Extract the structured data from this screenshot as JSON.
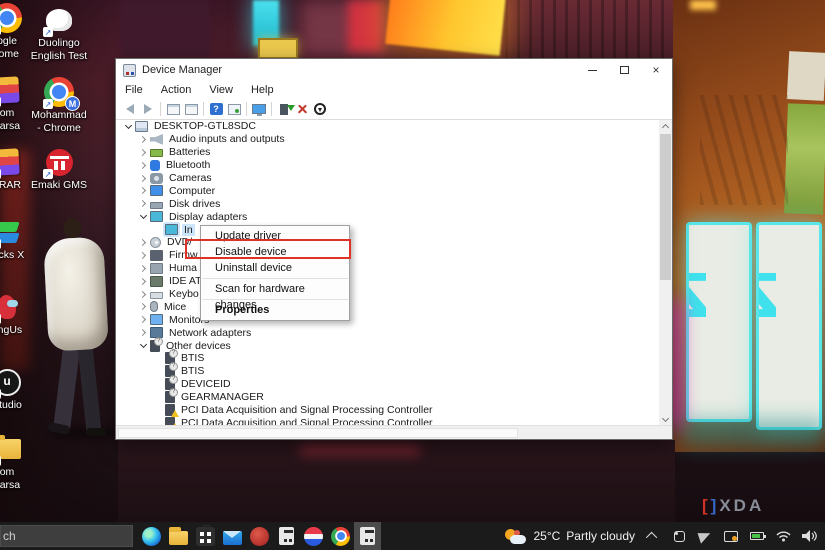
{
  "desktop": {
    "columns": [
      {
        "items": [
          {
            "art": "chrome",
            "lines": [
              "ogle",
              "rome"
            ]
          },
          {
            "art": "rar",
            "lines": [
              "om",
              "darsa"
            ]
          },
          {
            "art": "winrar",
            "lines": [
              "nRAR"
            ]
          },
          {
            "art": "bluestacks",
            "lines": [
              "tacks X"
            ]
          },
          {
            "art": "amongus",
            "lines": [
              "ongUs"
            ]
          },
          {
            "art": "studio",
            "lines": [
              "Studio"
            ]
          },
          {
            "art": "folder",
            "lines": [
              "om",
              "darsa"
            ]
          }
        ]
      },
      {
        "items": [
          {
            "art": "duolingo",
            "lines": [
              "Duolingo",
              "English Test"
            ]
          },
          {
            "art": "chrome-m",
            "lines": [
              "Mohammad",
              "- Chrome"
            ],
            "badge": "M"
          },
          {
            "art": "emaki",
            "lines": [
              "Emaki GMS"
            ]
          }
        ]
      }
    ]
  },
  "window": {
    "title": "Device Manager",
    "menubar": [
      "File",
      "Action",
      "View",
      "Help"
    ],
    "toolbar": [
      "back",
      "forward",
      "sep",
      "console-tree",
      "properties",
      "sep",
      "help",
      "console-window",
      "sep",
      "remote-desktop",
      "sep",
      "update-driver",
      "uninstall",
      "disable-device"
    ],
    "tree": [
      {
        "label": "DESKTOP-GTL8SDC",
        "level": 0,
        "state": "expanded",
        "icon": "computer-icon"
      },
      {
        "label": "Audio inputs and outputs",
        "level": 1,
        "state": "collapsed",
        "icon": "audio-icon"
      },
      {
        "label": "Batteries",
        "level": 1,
        "state": "collapsed",
        "icon": "battery-icon"
      },
      {
        "label": "Bluetooth",
        "level": 1,
        "state": "collapsed",
        "icon": "bluetooth-icon"
      },
      {
        "label": "Cameras",
        "level": 1,
        "state": "collapsed",
        "icon": "camera-icon"
      },
      {
        "label": "Computer",
        "level": 1,
        "state": "collapsed",
        "icon": "monitor-icon"
      },
      {
        "label": "Disk drives",
        "level": 1,
        "state": "collapsed",
        "icon": "disk-icon"
      },
      {
        "label": "Display adapters",
        "level": 1,
        "state": "expanded",
        "icon": "display-icon"
      },
      {
        "label": "In",
        "level": 2,
        "state": "leaf",
        "icon": "display-icon",
        "selected": true
      },
      {
        "label": "DVD/",
        "level": 1,
        "state": "collapsed",
        "icon": "dvd-icon"
      },
      {
        "label": "Firmw",
        "level": 1,
        "state": "collapsed",
        "icon": "firmware-icon"
      },
      {
        "label": "Huma",
        "level": 1,
        "state": "collapsed",
        "icon": "hid-icon"
      },
      {
        "label": "IDE AT",
        "level": 1,
        "state": "collapsed",
        "icon": "ide-icon"
      },
      {
        "label": "Keybo",
        "level": 1,
        "state": "collapsed",
        "icon": "keyboard-icon"
      },
      {
        "label": "Mice",
        "level": 1,
        "state": "collapsed",
        "icon": "mouse-icon"
      },
      {
        "label": "Monitors",
        "level": 1,
        "state": "collapsed",
        "icon": "monitor2-icon"
      },
      {
        "label": "Network adapters",
        "level": 1,
        "state": "collapsed",
        "icon": "network-icon"
      },
      {
        "label": "Other devices",
        "level": 1,
        "state": "expanded",
        "icon": "unknown-icon"
      },
      {
        "label": "BTIS",
        "level": 2,
        "state": "leaf",
        "icon": "unknown-icon"
      },
      {
        "label": "BTIS",
        "level": 2,
        "state": "leaf",
        "icon": "unknown-icon"
      },
      {
        "label": "DEVICEID",
        "level": 2,
        "state": "leaf",
        "icon": "unknown-icon"
      },
      {
        "label": "GEARMANAGER",
        "level": 2,
        "state": "leaf",
        "icon": "unknown-icon"
      },
      {
        "label": "PCI Data Acquisition and Signal Processing Controller",
        "level": 2,
        "state": "leaf",
        "icon": "warning-icon"
      },
      {
        "label": "PCI Data Acquisition and Signal Processing Controller",
        "level": 2,
        "state": "leaf",
        "icon": "warning-icon"
      }
    ],
    "context_menu": {
      "items": [
        "Update driver",
        "Disable device",
        "Uninstall device",
        "Scan for hardware changes",
        "Properties"
      ],
      "separators_after": [
        2,
        3
      ],
      "bold_index": 4,
      "annotated_index": 1,
      "annotation_color": "#de3226"
    }
  },
  "taskbar": {
    "search_value": "ch",
    "apps": [
      "edge",
      "file-explorer",
      "store",
      "mail",
      "brave",
      "device-manager",
      "media-app",
      "chrome",
      "device-manager-active"
    ],
    "active_index": 8
  },
  "tray": {
    "temperature": "25°C",
    "condition": "Partly cloudy",
    "icons": [
      "chevron-up",
      "tray-app",
      "send",
      "screen-cast",
      "battery",
      "wifi",
      "volume"
    ]
  },
  "watermark": {
    "bracket_left": "[",
    "bracket_right": "]",
    "text": "XDA"
  }
}
